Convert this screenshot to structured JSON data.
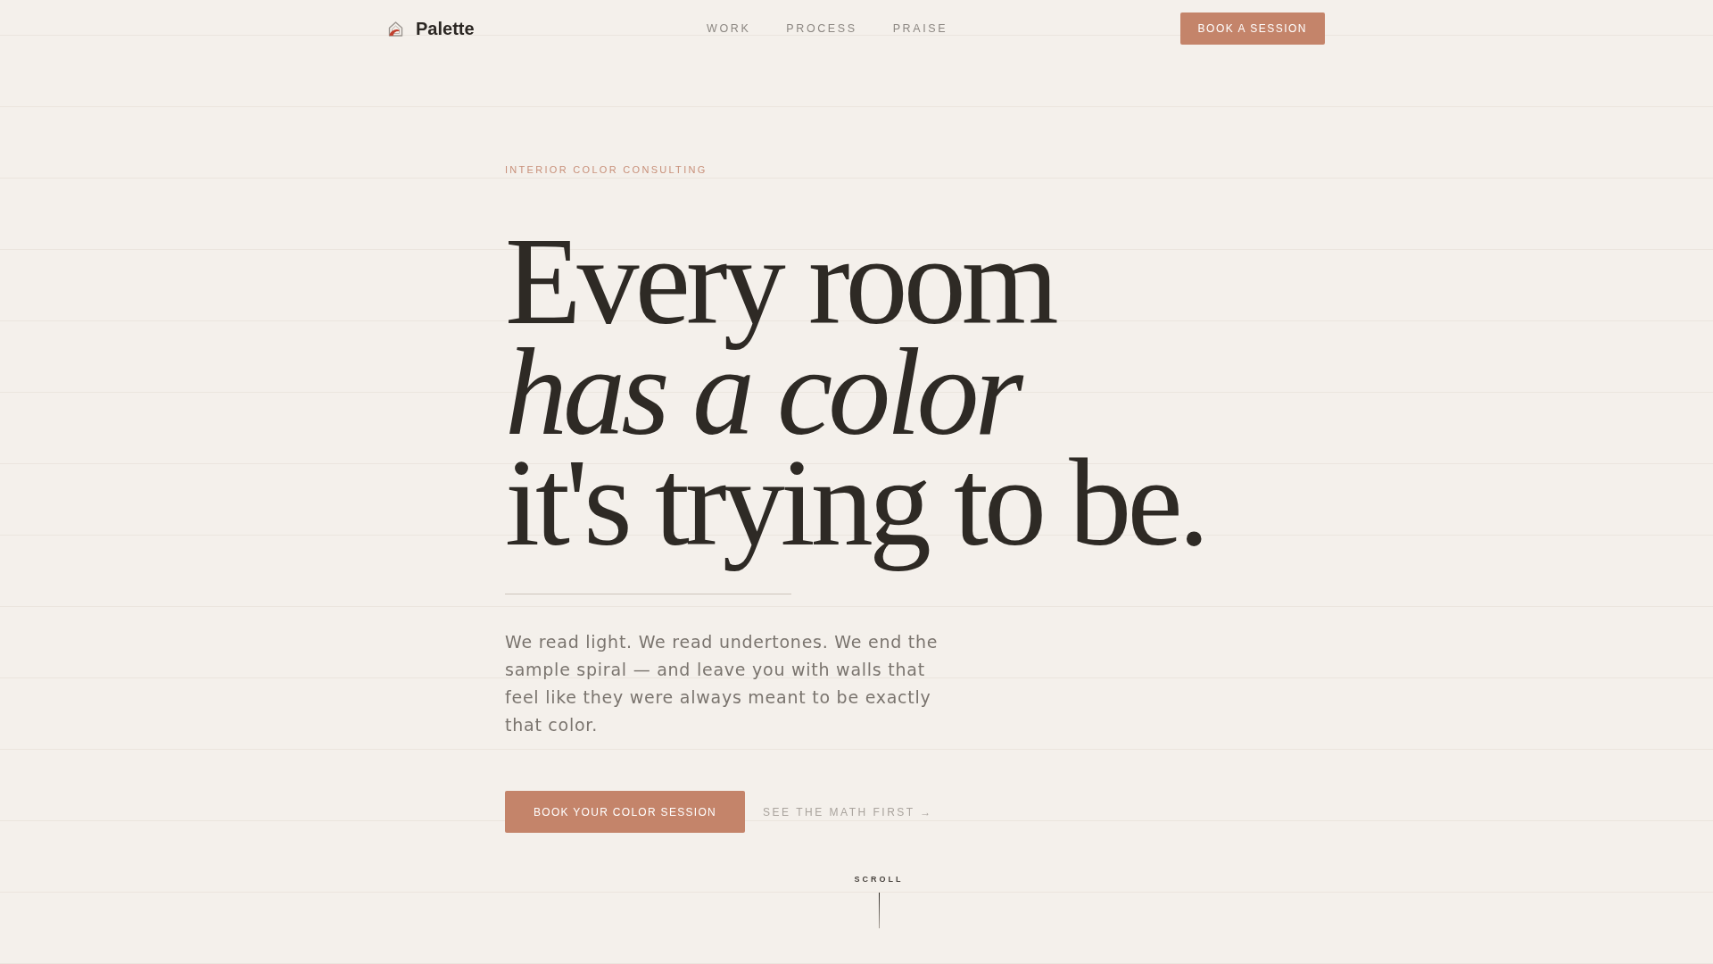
{
  "nav": {
    "brand": "Palette",
    "links": [
      "WORK",
      "PROCESS",
      "PRAISE"
    ],
    "cta": "BOOK A SESSION"
  },
  "hero": {
    "eyebrow": "INTERIOR COLOR CONSULTING",
    "heading_lines": [
      "Every room",
      "*has a color*",
      "it's trying to be."
    ],
    "body": "We read light. We read undertones. We end the sample spiral — and leave you with walls that feel like they were always meant to be exactly that color.",
    "primary_cta": "BOOK YOUR COLOR SESSION",
    "secondary_link": "SEE THE MATH FIRST →"
  },
  "scroll_hint": "SCROLL"
}
